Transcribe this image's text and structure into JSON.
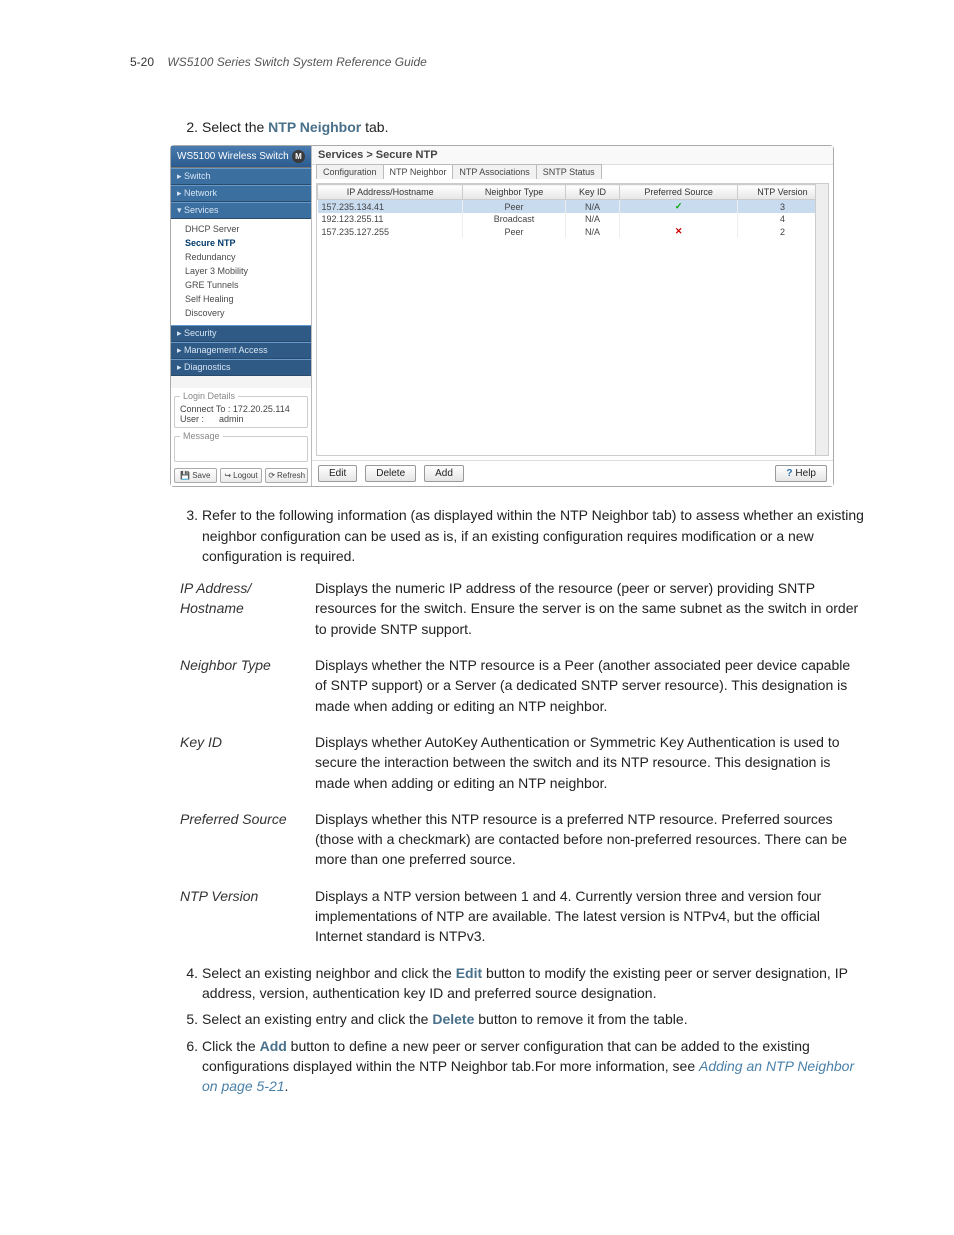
{
  "header": {
    "page_num": "5-20",
    "title": "WS5100 Series Switch System Reference Guide"
  },
  "step2": {
    "num": "2.",
    "pre": "Select the ",
    "link": "NTP Neighbor",
    "post": " tab."
  },
  "app": {
    "product": "WS5100 Wireless Switch",
    "breadcrumb": "Services > Secure NTP",
    "tabs": [
      "Configuration",
      "NTP Neighbor",
      "NTP Associations",
      "SNTP Status"
    ],
    "nav_sections": {
      "switch": "▸ Switch",
      "network": "▸ Network",
      "services": "▾ Services",
      "security": "▸ Security",
      "mgmt": "▸ Management Access",
      "diag": "▸ Diagnostics"
    },
    "tree": [
      "DHCP Server",
      "Secure NTP",
      "Redundancy",
      "Layer 3 Mobility",
      "GRE Tunnels",
      "Self Healing",
      "Discovery"
    ],
    "login": {
      "legend": "Login Details",
      "connect_label": "Connect To :",
      "connect": "172.20.25.114",
      "user_label": "User :",
      "user": "admin"
    },
    "message_legend": "Message",
    "buttons": {
      "save": "Save",
      "logout": "Logout",
      "refresh": "Refresh"
    },
    "cols": [
      "IP Address/Hostname",
      "Neighbor Type",
      "Key ID",
      "Preferred Source",
      "NTP Version"
    ],
    "rows": [
      {
        "ip": "157.235.134.41",
        "type": "Peer",
        "key": "N/A",
        "pref": "check",
        "ver": "3"
      },
      {
        "ip": "192.123.255.11",
        "type": "Broadcast",
        "key": "N/A",
        "pref": "",
        "ver": "4"
      },
      {
        "ip": "157.235.127.255",
        "type": "Peer",
        "key": "N/A",
        "pref": "cross",
        "ver": "2"
      }
    ],
    "bottom_buttons": {
      "edit": "Edit",
      "delete": "Delete",
      "add": "Add",
      "help": "Help"
    }
  },
  "step3": {
    "num": "3.",
    "text": "Refer to the following information (as displayed within the NTP Neighbor tab) to assess whether an existing neighbor configuration can be used as is, if an existing configuration requires modification or a new configuration is required."
  },
  "defs": [
    {
      "term": "IP Address/\nHostname",
      "desc": "Displays the numeric IP address of the resource (peer or server) providing SNTP resources for the switch. Ensure the server is on the same subnet as the switch in order to provide SNTP support."
    },
    {
      "term": "Neighbor Type",
      "desc": "Displays whether the NTP resource is a Peer (another associated peer device capable of SNTP support) or a Server (a dedicated SNTP server resource). This designation is made when adding or editing an NTP neighbor."
    },
    {
      "term": "Key ID",
      "desc": "Displays whether AutoKey Authentication or Symmetric Key Authentication is used to secure the interaction between the switch and its NTP resource. This designation is made when adding or editing an NTP neighbor."
    },
    {
      "term": "Preferred Source",
      "desc": "Displays whether this NTP resource is a preferred NTP resource. Preferred sources (those with a checkmark) are contacted before non-preferred resources. There can be more than one preferred source."
    },
    {
      "term": "NTP Version",
      "desc": "Displays a NTP version between 1 and 4. Currently version three and version four implementations of NTP are available. The latest version is NTPv4, but the official Internet standard is NTPv3."
    }
  ],
  "step4": {
    "num": "4.",
    "pre": "Select an existing neighbor and click the ",
    "link": "Edit",
    "post": " button to modify the existing peer or server designation, IP address, version, authentication key ID and preferred source designation."
  },
  "step5": {
    "num": "5.",
    "pre": "Select an existing entry and click the ",
    "link": "Delete",
    "post": " button to remove it from the table."
  },
  "step6": {
    "num": "6.",
    "pre": "Click the ",
    "link": "Add",
    "mid": " button to define a new peer or server configuration that can be added to the existing configurations displayed within the NTP Neighbor tab.For more information, see ",
    "xref": "Adding an NTP Neighbor on page 5-21",
    "post": "."
  }
}
